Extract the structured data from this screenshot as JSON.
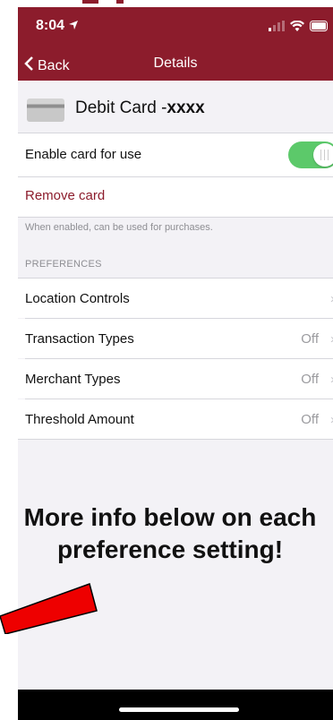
{
  "status": {
    "time": "8:04",
    "location_icon": "location-arrow-icon",
    "signal_icon": "signal-icon",
    "wifi_icon": "wifi-icon",
    "battery_icon": "battery-icon"
  },
  "nav": {
    "back_label": "Back",
    "title": "Details"
  },
  "card": {
    "name_prefix": "Debit Card -",
    "number_masked": "xxxx"
  },
  "settings": {
    "enable_label": "Enable card for use",
    "enable_state": true,
    "remove_label": "Remove card",
    "note": "When enabled, can be used for purchases."
  },
  "preferences": {
    "header": "PREFERENCES",
    "items": [
      {
        "label": "Location Controls",
        "value": ""
      },
      {
        "label": "Transaction Types",
        "value": "Off"
      },
      {
        "label": "Merchant Types",
        "value": "Off"
      },
      {
        "label": "Threshold Amount",
        "value": "Off"
      }
    ]
  },
  "annotation": {
    "text": "More info below on each preference setting!"
  },
  "colors": {
    "brand": "#8c1c2c",
    "toggle_on": "#5cc96a",
    "arrow_red": "#ee0000"
  }
}
